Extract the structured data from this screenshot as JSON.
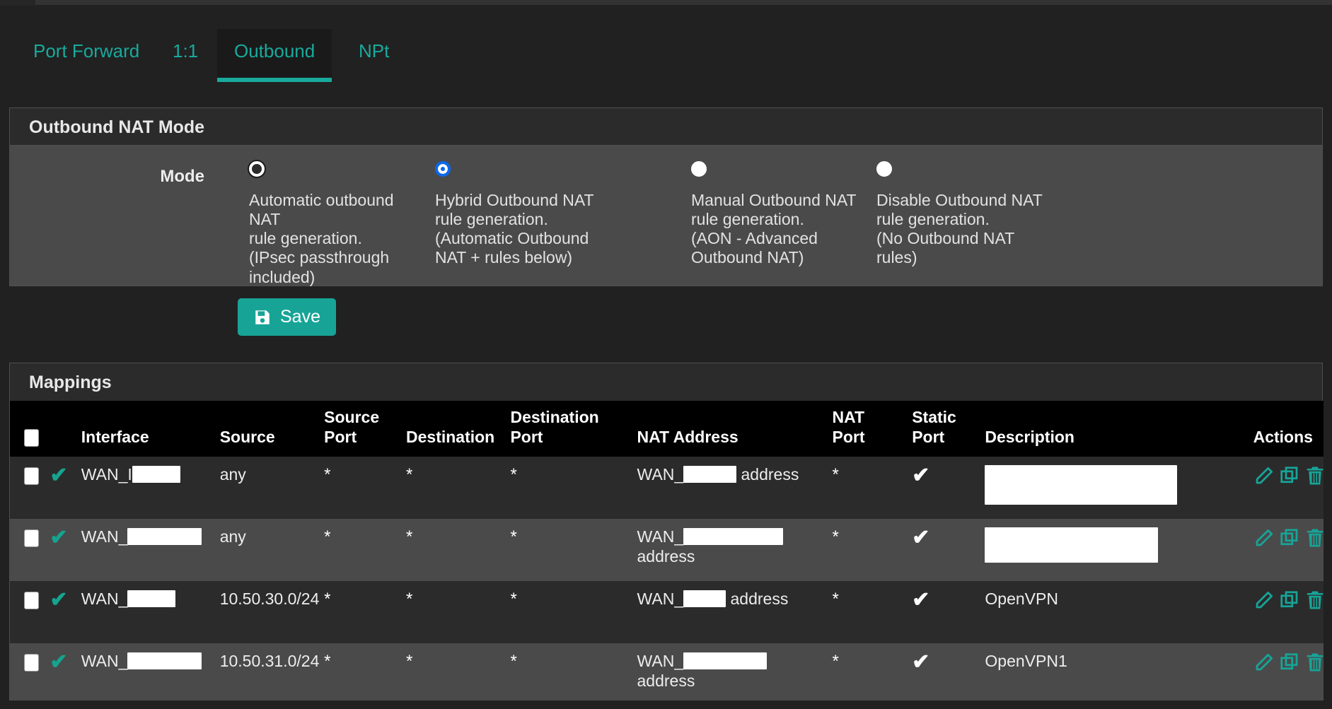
{
  "tabs": [
    {
      "label": "Port Forward",
      "active": false
    },
    {
      "label": "1:1",
      "active": false
    },
    {
      "label": "Outbound",
      "active": true
    },
    {
      "label": "NPt",
      "active": false
    }
  ],
  "mode_panel": {
    "title": "Outbound NAT Mode",
    "field_label": "Mode",
    "options": [
      {
        "desc": "Automatic outbound NAT\nrule generation.\n(IPsec passthrough\nincluded)",
        "state": "focused"
      },
      {
        "desc": "Hybrid Outbound NAT\nrule generation.\n(Automatic Outbound\nNAT + rules below)",
        "state": "checked"
      },
      {
        "desc": "Manual Outbound NAT\nrule generation.\n(AON - Advanced\nOutbound NAT)",
        "state": "unchecked"
      },
      {
        "desc": "Disable Outbound NAT\nrule generation.\n(No Outbound NAT rules)",
        "state": "unchecked"
      }
    ],
    "save_label": "Save",
    "save_icon": "floppy-disk-icon"
  },
  "mappings_panel": {
    "title": "Mappings",
    "columns": [
      "",
      "",
      "Interface",
      "Source",
      "Source\nPort",
      "Destination",
      "Destination\nPort",
      "NAT Address",
      "NAT\nPort",
      "Static\nPort",
      "Description",
      "Actions"
    ],
    "header_cols": {
      "interface": "Interface",
      "source": "Source",
      "source_port_l1": "Source",
      "source_port_l2": "Port",
      "destination": "Destination",
      "dest_port_l1": "Destination",
      "dest_port_l2": "Port",
      "nat_address": "NAT Address",
      "nat_port_l1": "NAT",
      "nat_port_l2": "Port",
      "static_port_l1": "Static",
      "static_port_l2": "Port",
      "description": "Description",
      "actions": "Actions"
    },
    "rows": [
      {
        "selected": false,
        "enabled": true,
        "interface_prefix": "WAN_I",
        "interface_redacted_width": 68,
        "source": "any",
        "source_port": "*",
        "destination": "*",
        "destination_port": "*",
        "nat_address_prefix": "WAN_",
        "nat_address_redacted_width": 75,
        "nat_address_suffix": " address",
        "nat_address_wrap": false,
        "nat_port": "*",
        "static_port": "yes",
        "description_redacted": true,
        "description_redacted_width": 272,
        "description_redacted_height": 56,
        "description": ""
      },
      {
        "selected": false,
        "enabled": true,
        "interface_prefix": "WAN_",
        "interface_redacted_width": 105,
        "source": "any",
        "source_port": "*",
        "destination": "*",
        "destination_port": "*",
        "nat_address_prefix": "WAN_",
        "nat_address_redacted_width": 141,
        "nat_address_suffix": "address",
        "nat_address_wrap": true,
        "nat_port": "*",
        "static_port": "yes",
        "description_redacted": true,
        "description_redacted_width": 245,
        "description_redacted_height": 50,
        "description": ""
      },
      {
        "selected": false,
        "enabled": true,
        "interface_prefix": "WAN_",
        "interface_redacted_width": 68,
        "source": "10.50.30.0/24",
        "source_port": "*",
        "destination": "*",
        "destination_port": "*",
        "nat_address_prefix": "WAN_",
        "nat_address_redacted_width": 60,
        "nat_address_suffix": " address",
        "nat_address_wrap": false,
        "nat_port": "*",
        "static_port": "yes",
        "description_redacted": false,
        "description": "OpenVPN"
      },
      {
        "selected": false,
        "enabled": true,
        "interface_prefix": "WAN_",
        "interface_redacted_width": 105,
        "source": "10.50.31.0/24",
        "source_port": "*",
        "destination": "*",
        "destination_port": "*",
        "nat_address_prefix": "WAN_",
        "nat_address_redacted_width": 118,
        "nat_address_suffix": "address",
        "nat_address_wrap": true,
        "nat_port": "*",
        "static_port": "yes",
        "description_redacted": false,
        "description": "OpenVPN1"
      }
    ],
    "action_icons": [
      "pencil-icon",
      "copy-icon",
      "trash-icon"
    ]
  },
  "colors": {
    "accent_teal": "#17a497",
    "tab_link": "#18aa9c",
    "radio_selected_blue": "#0a68f0",
    "panel_body": "#4a4a4a",
    "panel_heading": "#2b2b2b",
    "table_header": "#000000",
    "page_bg": "#212121"
  }
}
